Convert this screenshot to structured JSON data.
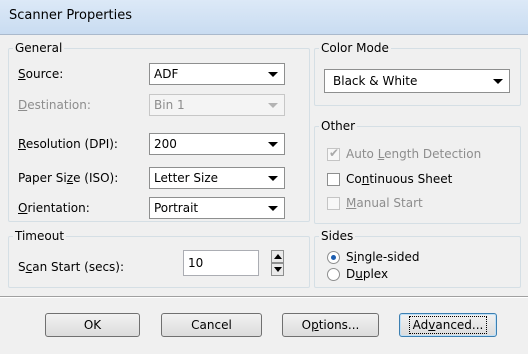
{
  "window": {
    "title": "Scanner Properties"
  },
  "general": {
    "group_title": "General",
    "source": {
      "label_key": "S",
      "label_rest": "ource:",
      "value": "ADF"
    },
    "destination": {
      "label_key": "D",
      "label_rest": "estination:",
      "value": "Bin 1",
      "disabled": true
    },
    "resolution": {
      "label_key": "R",
      "label_rest": "esolution (DPI):",
      "value": "200"
    },
    "paper_size": {
      "label_pre": "Paper Si",
      "label_key": "z",
      "label_rest": "e (ISO):",
      "value": "Letter Size"
    },
    "orientation": {
      "label_key": "O",
      "label_rest": "rientation:",
      "value": "Portrait"
    }
  },
  "color_mode": {
    "group_title": "Color Mode",
    "value": "Black & White"
  },
  "other": {
    "group_title": "Other",
    "auto_length": {
      "pre": "Auto ",
      "key": "L",
      "rest": "ength Detection",
      "checked": true,
      "disabled": true
    },
    "continuous": {
      "pre": "Co",
      "key": "n",
      "rest": "tinuous Sheet",
      "checked": false,
      "disabled": false
    },
    "manual_start": {
      "pre": "",
      "key": "M",
      "rest": "anual Start",
      "checked": false,
      "disabled": true
    }
  },
  "timeout": {
    "group_title": "Timeout",
    "label_pre": "S",
    "label_key": "c",
    "label_rest": "an Start (secs):",
    "value": "10"
  },
  "sides": {
    "group_title": "Sides",
    "single": {
      "pre": "S",
      "key": "i",
      "rest": "ngle-sided",
      "selected": true
    },
    "duplex": {
      "pre": "D",
      "key": "u",
      "rest": "plex",
      "selected": false
    }
  },
  "buttons": {
    "ok": "OK",
    "cancel": "Cancel",
    "options": {
      "pre": "O",
      "key": "p",
      "rest": "tions..."
    },
    "advanced": {
      "pre": "Ad",
      "key": "v",
      "rest": "anced..."
    }
  },
  "colors": {
    "accent": "#1c5db0",
    "title_bg": "#c9dcf1"
  }
}
